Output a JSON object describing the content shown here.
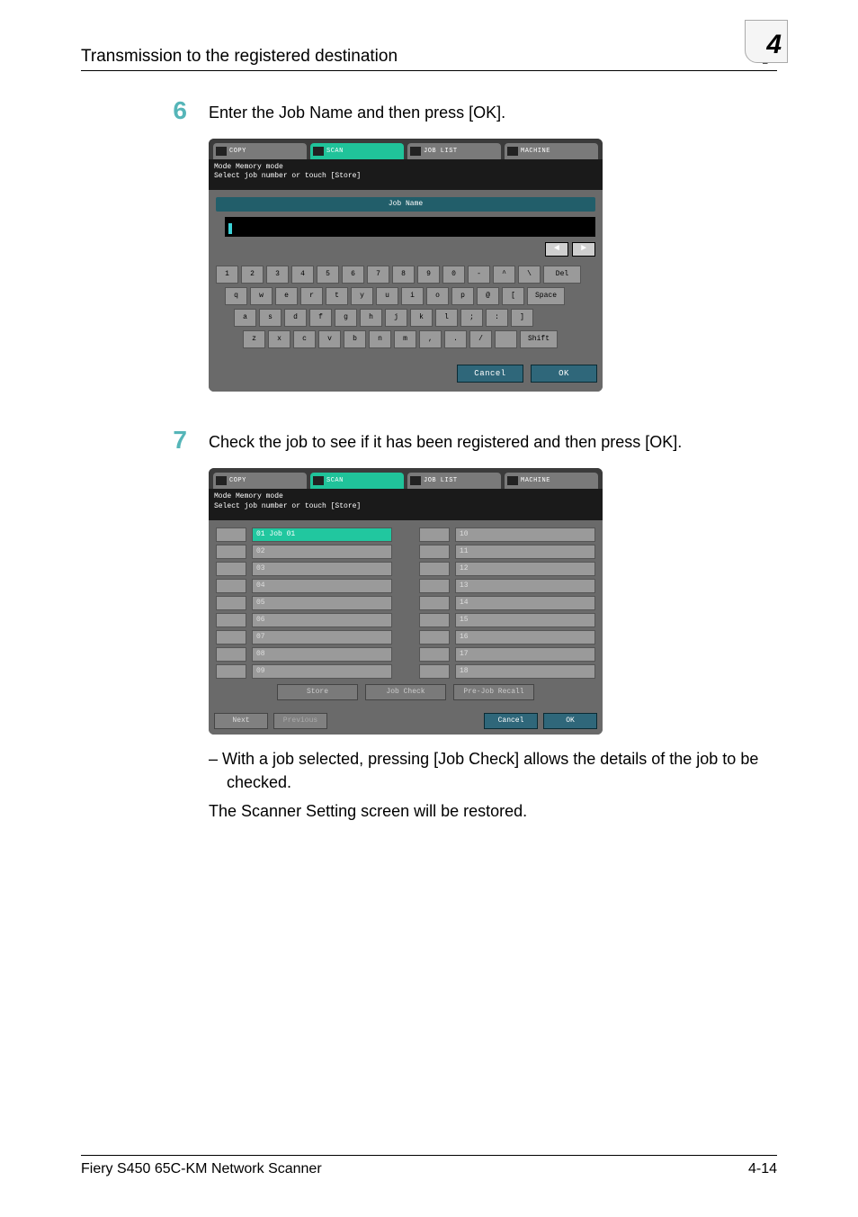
{
  "header": {
    "title": "Transmission to the registered destination",
    "chapter_number": "4"
  },
  "steps": {
    "step6": {
      "number": "6",
      "text": "Enter the Job Name and then press [OK]."
    },
    "step7": {
      "number": "7",
      "text": "Check the job to see if it has been registered and then press [OK].",
      "bullet": "–   With a job selected, pressing [Job Check] allows the details of the job to be checked.",
      "closing": "The Scanner Setting screen will be restored."
    }
  },
  "screenshot1": {
    "tabs": {
      "copy": "COPY",
      "scan": "SCAN",
      "joblist": "JOB LIST",
      "machine": "MACHINE"
    },
    "status_line1": "Mode Memory mode",
    "status_line2": "Select job number or touch [Store]",
    "jobname_label": "Job Name",
    "arrows": {
      "left": "◄",
      "right": "►"
    },
    "kb": {
      "row0": [
        "1",
        "2",
        "3",
        "4",
        "5",
        "6",
        "7",
        "8",
        "9",
        "0",
        "-",
        "^",
        "\\"
      ],
      "row0_del": "Del",
      "row1": [
        "q",
        "w",
        "e",
        "r",
        "t",
        "y",
        "u",
        "i",
        "o",
        "p",
        "@",
        "["
      ],
      "row1_space": "Space",
      "row2": [
        "a",
        "s",
        "d",
        "f",
        "g",
        "h",
        "j",
        "k",
        "l",
        ";",
        ":",
        "]"
      ],
      "row3": [
        "z",
        "x",
        "c",
        "v",
        "b",
        "n",
        "m",
        ",",
        ".",
        "/"
      ],
      "row3_shift": "Shift"
    },
    "footer": {
      "cancel": "Cancel",
      "ok": "OK"
    }
  },
  "screenshot2": {
    "tabs": {
      "copy": "COPY",
      "scan": "SCAN",
      "joblist": "JOB LIST",
      "machine": "MACHINE"
    },
    "status_line1": "Mode Memory mode",
    "status_line2": "Select job number or touch [Store]",
    "left_items": [
      {
        "num": "01",
        "label": "Job 01",
        "selected": true
      },
      {
        "num": "02",
        "label": "",
        "selected": false
      },
      {
        "num": "03",
        "label": "",
        "selected": false
      },
      {
        "num": "04",
        "label": "",
        "selected": false
      },
      {
        "num": "05",
        "label": "",
        "selected": false
      },
      {
        "num": "06",
        "label": "",
        "selected": false
      },
      {
        "num": "07",
        "label": "",
        "selected": false
      },
      {
        "num": "08",
        "label": "",
        "selected": false
      },
      {
        "num": "09",
        "label": "",
        "selected": false
      }
    ],
    "right_items": [
      "10",
      "11",
      "12",
      "13",
      "14",
      "15",
      "16",
      "17",
      "18"
    ],
    "actions": {
      "store": "Store",
      "jobcheck": "Job Check",
      "prejob": "Pre-Job Recall"
    },
    "nav": {
      "next": "Next",
      "previous": "Previous",
      "cancel": "Cancel",
      "ok": "OK"
    }
  },
  "footer": {
    "left": "Fiery S450 65C-KM Network Scanner",
    "right": "4-14"
  }
}
